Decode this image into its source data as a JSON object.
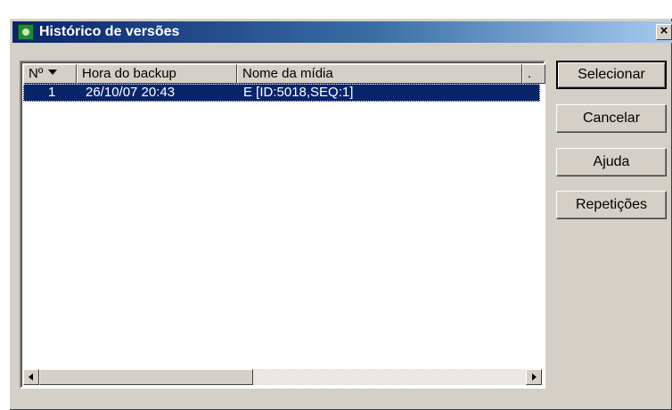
{
  "window": {
    "title": "Histórico de versões",
    "close_glyph": "×",
    "icon": "app-icon"
  },
  "list": {
    "columns": [
      {
        "label": "Nº",
        "sorted": "descending"
      },
      {
        "label": "Hora do backup"
      },
      {
        "label": "Nome da mídia"
      },
      {
        "label": "."
      }
    ],
    "rows": [
      {
        "num": "1",
        "time": "26/10/07 20:43",
        "media": "E [ID:5018,SEQ:1]",
        "selected": true
      }
    ]
  },
  "buttons": {
    "select": "Selecionar",
    "cancel": "Cancelar",
    "help": "Ajuda",
    "repeat": "Repetições"
  },
  "colors": {
    "selection": "#0a246a",
    "face": "#d4d0c8",
    "title_start": "#0a246a",
    "title_end": "#a6caf0"
  }
}
